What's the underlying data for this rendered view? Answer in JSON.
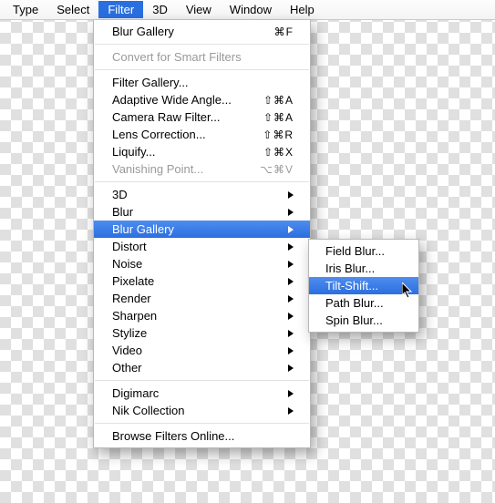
{
  "menubar": {
    "items": [
      "Type",
      "Select",
      "Filter",
      "3D",
      "View",
      "Window",
      "Help"
    ],
    "active_index": 2
  },
  "menu": {
    "groups": [
      [
        {
          "label": "Blur Gallery",
          "shortcut": "⌘F",
          "submenu": false,
          "disabled": false
        }
      ],
      [
        {
          "label": "Convert for Smart Filters",
          "shortcut": "",
          "submenu": false,
          "disabled": true
        }
      ],
      [
        {
          "label": "Filter Gallery...",
          "shortcut": "",
          "submenu": false,
          "disabled": false
        },
        {
          "label": "Adaptive Wide Angle...",
          "shortcut": "⇧⌘A",
          "submenu": false,
          "disabled": false
        },
        {
          "label": "Camera Raw Filter...",
          "shortcut": "⇧⌘A",
          "submenu": false,
          "disabled": false
        },
        {
          "label": "Lens Correction...",
          "shortcut": "⇧⌘R",
          "submenu": false,
          "disabled": false
        },
        {
          "label": "Liquify...",
          "shortcut": "⇧⌘X",
          "submenu": false,
          "disabled": false
        },
        {
          "label": "Vanishing Point...",
          "shortcut": "⌥⌘V",
          "submenu": false,
          "disabled": true
        }
      ],
      [
        {
          "label": "3D",
          "shortcut": "",
          "submenu": true,
          "disabled": false
        },
        {
          "label": "Blur",
          "shortcut": "",
          "submenu": true,
          "disabled": false
        },
        {
          "label": "Blur Gallery",
          "shortcut": "",
          "submenu": true,
          "disabled": false,
          "highlight": true
        },
        {
          "label": "Distort",
          "shortcut": "",
          "submenu": true,
          "disabled": false
        },
        {
          "label": "Noise",
          "shortcut": "",
          "submenu": true,
          "disabled": false
        },
        {
          "label": "Pixelate",
          "shortcut": "",
          "submenu": true,
          "disabled": false
        },
        {
          "label": "Render",
          "shortcut": "",
          "submenu": true,
          "disabled": false
        },
        {
          "label": "Sharpen",
          "shortcut": "",
          "submenu": true,
          "disabled": false
        },
        {
          "label": "Stylize",
          "shortcut": "",
          "submenu": true,
          "disabled": false
        },
        {
          "label": "Video",
          "shortcut": "",
          "submenu": true,
          "disabled": false
        },
        {
          "label": "Other",
          "shortcut": "",
          "submenu": true,
          "disabled": false
        }
      ],
      [
        {
          "label": "Digimarc",
          "shortcut": "",
          "submenu": true,
          "disabled": false
        },
        {
          "label": "Nik Collection",
          "shortcut": "",
          "submenu": true,
          "disabled": false
        }
      ],
      [
        {
          "label": "Browse Filters Online...",
          "shortcut": "",
          "submenu": false,
          "disabled": false
        }
      ]
    ]
  },
  "submenu": {
    "items": [
      {
        "label": "Field Blur...",
        "highlight": false
      },
      {
        "label": "Iris Blur...",
        "highlight": false
      },
      {
        "label": "Tilt-Shift...",
        "highlight": true
      },
      {
        "label": "Path Blur...",
        "highlight": false
      },
      {
        "label": "Spin Blur...",
        "highlight": false
      }
    ]
  }
}
